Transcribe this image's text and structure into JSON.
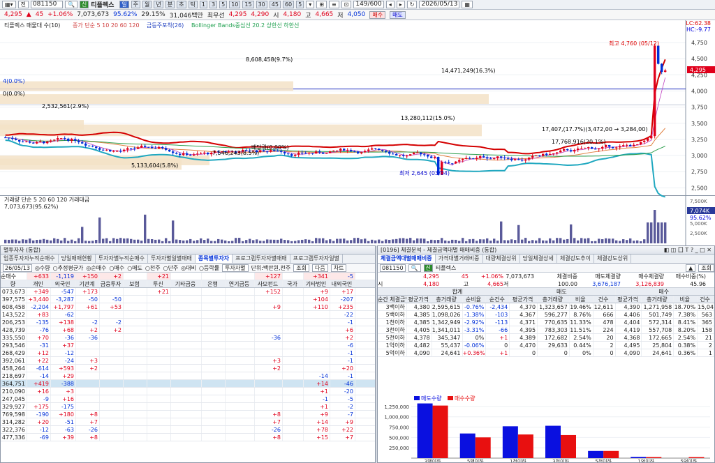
{
  "toolbar": {
    "code": "081150",
    "mode": "전",
    "badge": "신",
    "name": "티플렉스",
    "periods": [
      "일",
      "주",
      "월",
      "년",
      "분",
      "초",
      "틱"
    ],
    "mins": [
      "1",
      "3",
      "5",
      "10",
      "15",
      "30",
      "45",
      "60",
      "5"
    ],
    "page": "149/600",
    "date": "2026/05/13"
  },
  "quote": {
    "price": "4,295",
    "change": "45",
    "pct": "+1.06%",
    "volume": "7,073,673",
    "ratio": "95.62%",
    "turn": "29.15%",
    "amount": "31,046백만",
    "best": "최우선",
    "ask": "4,295",
    "bid": "4,290",
    "open_l": "시",
    "open": "4,180",
    "high_l": "고",
    "high": "4,665",
    "close_l": "저",
    "low": "4,050",
    "sell": "매수",
    "buy": "매도"
  },
  "chart": {
    "legend": "티플렉스 매물대 수(10)",
    "ma": "종가 단순 5 10 20 60 120",
    "bw": "금등주포착(26)",
    "bb": "Bollinger Bands중심선 20.2 상한선 하한선",
    "lc": "LC:62.38",
    "hc": "HC:-9.77",
    "vp": [
      "8,608,458(9.7%)",
      "14,471,249(16.3%)",
      "2,532,561(2.9%)",
      "13,280,112(15.0%)",
      "7,546,243(8.5%)",
      "5,133,604(5.8%)",
      "17,407,(17.7%)(3,472,00 → 3,284,00)",
      "17,768,916(20.1%)"
    ],
    "hi": "최고 4,760 (05/12)",
    "lo": "최저 2,645 (03/04)",
    "div": "배당락(0.00%)",
    "p1": "4(0.0%)",
    "p2": "0(0.0%)",
    "cur": "4,295",
    "ticks": [
      "4,750",
      "4,500",
      "4,250",
      "4,000",
      "3,750",
      "3,500",
      "3,250",
      "3,000",
      "2,750",
      "2,500"
    ],
    "vlegend": "거래량 단순 5 20 60 120 거래대금",
    "vval": "7,073,673(95.62%)",
    "vcur": "7,074K",
    "vpct": "95.62%",
    "vticks": [
      "7,500K",
      "5,000K",
      "2,500K"
    ]
  },
  "left": {
    "title": "별투자자 (통합)",
    "tabs": [
      "업종투자자누적순매수",
      "당일매매현황",
      "투자자별누적순매수",
      "투자자별일별매매",
      "종목별투자자",
      "프로그램투자자별매매",
      "프로그램투자자일별"
    ],
    "ctl": [
      "◎수량",
      "○추정평균가",
      "◎순매수",
      "○매수",
      "○매도",
      "○천주",
      "○단주",
      "◎대비",
      "○등락률",
      "투자자별",
      "단위:백만원,천주",
      "조회",
      "다음",
      "차트"
    ],
    "date": "26/05/13",
    "totals": [
      "+633",
      "-1,119",
      "+150",
      "+2",
      "+21",
      "+127",
      "+341",
      "-5"
    ],
    "hdr": [
      "량",
      "개인",
      "외국인",
      "기관계",
      "금융투자",
      "보험",
      "투신",
      "기타금융",
      "은행",
      "연기금등",
      "사모펀드",
      "국가",
      "기타법인",
      "내외국인"
    ],
    "rows": [
      [
        "073,673",
        "+349",
        "-547",
        "+173",
        "",
        "",
        "+21",
        "",
        "",
        "",
        "+152",
        "",
        "+9",
        "+17"
      ],
      [
        "397,575",
        "+3,440",
        "-3,287",
        "-50",
        "-50",
        "",
        "",
        "",
        "",
        "",
        "",
        "",
        "+104",
        "-207"
      ],
      [
        "608,458",
        "-2,204",
        "+1,797",
        "+61",
        "+53",
        "",
        "",
        "",
        "",
        "",
        "+9",
        "",
        "+110",
        "+235"
      ],
      [
        "143,522",
        "+83",
        "-62",
        "",
        "",
        "",
        "",
        "",
        "",
        "",
        "",
        "",
        "",
        "-22"
      ],
      [
        "206,253",
        "-135",
        "+138",
        "-2",
        "-2",
        "",
        "",
        "",
        "",
        "",
        "",
        "",
        "",
        "-1"
      ],
      [
        "428,739",
        "-76",
        "+68",
        "+2",
        "+2",
        "",
        "",
        "",
        "",
        "",
        "",
        "",
        "",
        "+6"
      ],
      [
        "335,550",
        "+70",
        "-36",
        "-36",
        "",
        "",
        "",
        "",
        "",
        "",
        "-36",
        "",
        "",
        "+2"
      ],
      [
        "293,546",
        "-31",
        "+37",
        "",
        "",
        "",
        "",
        "",
        "",
        "",
        "",
        "",
        "",
        "-6"
      ],
      [
        "268,429",
        "+12",
        "-12",
        "",
        "",
        "",
        "",
        "",
        "",
        "",
        "",
        "",
        "",
        "-1"
      ],
      [
        "392,061",
        "+22",
        "-24",
        "+3",
        "",
        "",
        "",
        "",
        "",
        "",
        "+3",
        "",
        "",
        "-1"
      ],
      [
        "458,264",
        "-614",
        "+593",
        "+2",
        "",
        "",
        "",
        "",
        "",
        "",
        "+2",
        "",
        "",
        "+20"
      ],
      [
        "218,697",
        "-14",
        "+29",
        "",
        "",
        "",
        "",
        "",
        "",
        "",
        "",
        "",
        "-14",
        "-1"
      ],
      [
        "364,751",
        "+419",
        "-388",
        "",
        "",
        "",
        "",
        "",
        "",
        "",
        "",
        "",
        "+14",
        "-46"
      ],
      [
        "210,090",
        "+16",
        "+3",
        "",
        "",
        "",
        "",
        "",
        "",
        "",
        "",
        "",
        "+1",
        "-20"
      ],
      [
        "247,045",
        "-9",
        "+16",
        "",
        "",
        "",
        "",
        "",
        "",
        "",
        "",
        "",
        "-1",
        "-5"
      ],
      [
        "329,927",
        "+175",
        "-175",
        "",
        "",
        "",
        "",
        "",
        "",
        "",
        "",
        "",
        "+1",
        "-2"
      ],
      [
        "769,598",
        "-190",
        "+180",
        "+8",
        "",
        "",
        "",
        "",
        "",
        "",
        "+8",
        "",
        "+9",
        "-7"
      ],
      [
        "314,282",
        "+20",
        "-51",
        "+7",
        "",
        "",
        "",
        "",
        "",
        "",
        "+7",
        "",
        "+14",
        "+9"
      ],
      [
        "322,376",
        "-12",
        "-63",
        "-26",
        "",
        "",
        "",
        "",
        "",
        "",
        "-26",
        "",
        "+78",
        "+22"
      ],
      [
        "477,336",
        "-69",
        "+39",
        "+8",
        "",
        "",
        "",
        "",
        "",
        "",
        "+8",
        "",
        "+15",
        "+7"
      ]
    ]
  },
  "right": {
    "title": "[0196] 체결분석 - 체결금액대별 매매비중 (통합)",
    "tabs": [
      "체결금액대별매매비중",
      "가격대별거래비중",
      "대량체결상위",
      "당일체결상세",
      "체결강도추이",
      "체결강도상위"
    ],
    "code": "081150",
    "badge": "신",
    "name": "티플렉스",
    "search": "조회",
    "price": "4,295",
    "chg": "45",
    "pct": "+1.06%",
    "vol": "7,073,673",
    "open": "4,180",
    "high": "4,665",
    "low": "4,050",
    "lbl_open": "시",
    "lbl_high": "고",
    "lbl_low": "저",
    "sum_h": [
      "체결비중",
      "매도체결량",
      "매수체결량",
      "매수비중(%)"
    ],
    "sum_v": [
      "100.00",
      "3,676,187",
      "3,126,839",
      "45.96"
    ],
    "grp": [
      "합계",
      "매도",
      "매수"
    ],
    "hdr": [
      "순간\n체결금액",
      "평균가격",
      "총거래량",
      "순비율",
      "순건수",
      "평균가격",
      "총거래량",
      "비율",
      "건수",
      "평균가격",
      "총거래량",
      "비율",
      "건수"
    ],
    "rows": [
      [
        "3백이하",
        "4,380",
        "2,595,615",
        "-0.76%",
        "-2,434",
        "4,370",
        "1,323,657",
        "19.46%",
        "12,611",
        "4,390",
        "1,271,958",
        "18.70%",
        "15,045"
      ],
      [
        "5백이하",
        "4,385",
        "1,098,026",
        "-1.38%",
        "-103",
        "4,367",
        "596,277",
        "8.76%",
        "666",
        "4,406",
        "501,749",
        "7.38%",
        "563"
      ],
      [
        "1천이하",
        "4,385",
        "1,342,949",
        "-2.92%",
        "-113",
        "4,371",
        "770,635",
        "11.33%",
        "478",
        "4,404",
        "572,314",
        "8.41%",
        "365"
      ],
      [
        "3천이하",
        "4,405",
        "1,341,011",
        "-3.31%",
        "-66",
        "4,395",
        "783,303",
        "11.51%",
        "224",
        "4,419",
        "557,708",
        "8.20%",
        "158"
      ],
      [
        "5천이하",
        "4,378",
        "345,347",
        "0%",
        "+1",
        "4,389",
        "172,682",
        "2.54%",
        "20",
        "4,368",
        "172,665",
        "2.54%",
        "21"
      ],
      [
        "1억이하",
        "4,482",
        "55,437",
        "-0.06%",
        "0",
        "4,470",
        "29,633",
        "0.44%",
        "2",
        "4,495",
        "25,804",
        "0.38%",
        "2"
      ],
      [
        "5억이하",
        "4,090",
        "24,641",
        "+0.36%",
        "+1",
        "0",
        "0",
        "0%",
        "0",
        "4,090",
        "24,641",
        "0.36%",
        "1"
      ]
    ],
    "bars": {
      "legend_sell": "매도수량",
      "legend_buy": "매수수량",
      "categories": [
        "3백이하",
        "5백이하",
        "1천이하",
        "3천이하",
        "5천이하",
        "1억이하",
        "5억이하"
      ],
      "yticks": [
        "1,250,000",
        "1,000,000",
        "750,000",
        "500,000",
        "250,000"
      ]
    }
  },
  "chart_data": {
    "type": "bar",
    "categories": [
      "3백이하",
      "5백이하",
      "1천이하",
      "3천이하",
      "5천이하",
      "1억이하",
      "5억이하"
    ],
    "series": [
      {
        "name": "매도수량",
        "values": [
          1323657,
          596277,
          770635,
          783303,
          172682,
          29633,
          0
        ]
      },
      {
        "name": "매수수량",
        "values": [
          1271958,
          501749,
          572314,
          557708,
          172665,
          25804,
          24641
        ]
      }
    ],
    "title": "",
    "xlabel": "",
    "ylabel": "",
    "ylim": [
      0,
      1350000
    ]
  },
  "colors": {
    "up": "#e0001b",
    "down": "#0030d8",
    "bbu": "#d40000",
    "bbl": "#20a8c0",
    "vp": "#f3e2c7"
  }
}
